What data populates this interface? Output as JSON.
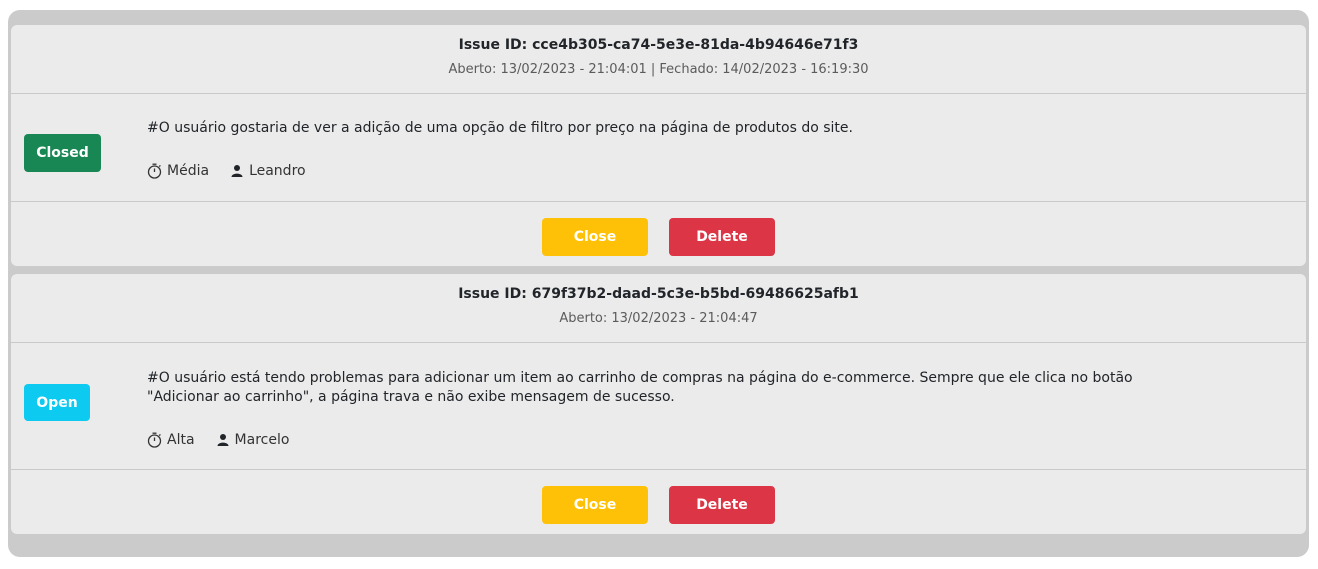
{
  "issues": [
    {
      "issue_id": "Issue ID: cce4b305-ca74-5e3e-81da-4b94646e71f3",
      "dates": "Aberto: 13/02/2023 - 21:04:01 | Fechado: 14/02/2023 - 16:19:30",
      "status": "Closed",
      "status_color": "#198754",
      "description": "#O usuário gostaria de ver a adição de uma opção de filtro por preço na página de produtos do site.",
      "severity": "Média",
      "responsible": "Leandro",
      "close_label": "Close",
      "delete_label": "Delete"
    },
    {
      "issue_id": "Issue ID: 679f37b2-daad-5c3e-b5bd-69486625afb1",
      "dates": "Aberto: 13/02/2023 - 21:04:47",
      "status": "Open",
      "status_color": "#0dcaf0",
      "description": "#O usuário está tendo problemas para adicionar um item ao carrinho de compras na página do e-commerce. Sempre que ele clica no botão \"Adicionar ao carrinho\", a página trava e não exibe mensagem de sucesso.",
      "severity": "Alta",
      "responsible": "Marcelo",
      "close_label": "Close",
      "delete_label": "Delete"
    }
  ],
  "icons": {
    "severity": "stopwatch-icon",
    "responsible": "person-icon"
  },
  "colors": {
    "close_button": "#ffc107",
    "delete_button": "#dc3545",
    "background": "#cbcbcb",
    "card": "#ebebeb"
  }
}
